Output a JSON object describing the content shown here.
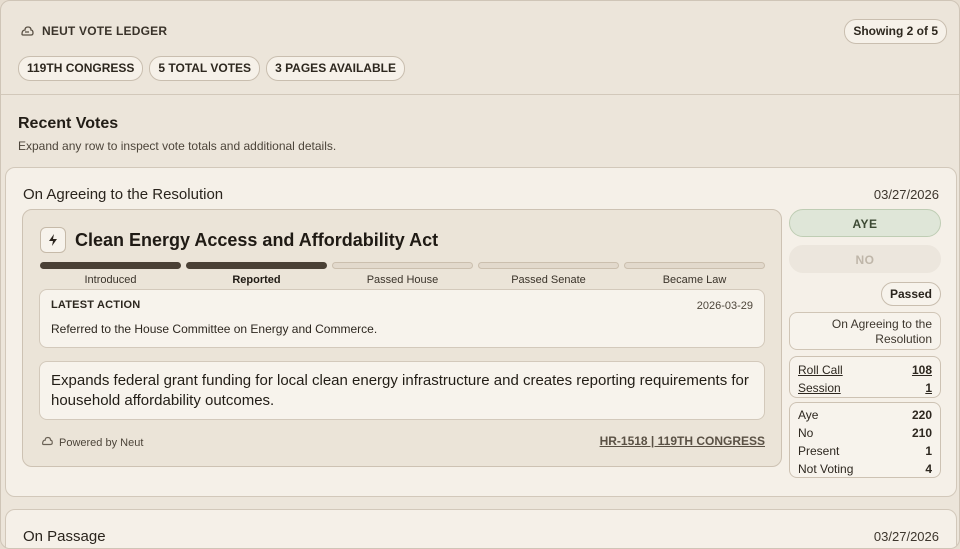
{
  "header": {
    "brand": "NEUT VOTE LEDGER",
    "showing": "Showing 2 of 5",
    "chips": [
      "119TH CONGRESS",
      "5 TOTAL VOTES",
      "3 PAGES AVAILABLE"
    ]
  },
  "section": {
    "title": "Recent Votes",
    "subtitle": "Expand any row to inspect vote totals and additional details."
  },
  "votes": [
    {
      "question": "On Agreeing to the Resolution",
      "date": "03/27/2026",
      "bill": {
        "title": "Clean Energy Access and Affordability Act",
        "stages": [
          "Introduced",
          "Reported",
          "Passed House",
          "Passed Senate",
          "Became Law"
        ],
        "stages_completed": 2,
        "latest_action_label": "LATEST ACTION",
        "latest_action_date": "2026-03-29",
        "latest_action_text": "Referred to the House Committee on Energy and Commerce.",
        "summary": "Expands federal grant funding for local clean energy infrastructure and creates reporting requirements for household affordability outcomes.",
        "powered_by": "Powered by Neut",
        "reference": "HR-1518 | 119TH CONGRESS"
      },
      "positions": {
        "aye": "AYE",
        "no": "NO",
        "selected": "AYE"
      },
      "result": "Passed",
      "question_detail": "On Agreeing to the Resolution",
      "meta": {
        "roll_call_label": "Roll Call",
        "roll_call": "108",
        "session_label": "Session",
        "session": "1"
      },
      "tally": [
        {
          "label": "Aye",
          "value": "220"
        },
        {
          "label": "No",
          "value": "210"
        },
        {
          "label": "Present",
          "value": "1"
        },
        {
          "label": "Not Voting",
          "value": "4"
        }
      ]
    },
    {
      "question": "On Passage",
      "date": "03/27/2026"
    }
  ],
  "colors": {
    "accent_dark": "#4a4035",
    "aye_bg": "#dfe6d8",
    "background": "#ece5da"
  }
}
